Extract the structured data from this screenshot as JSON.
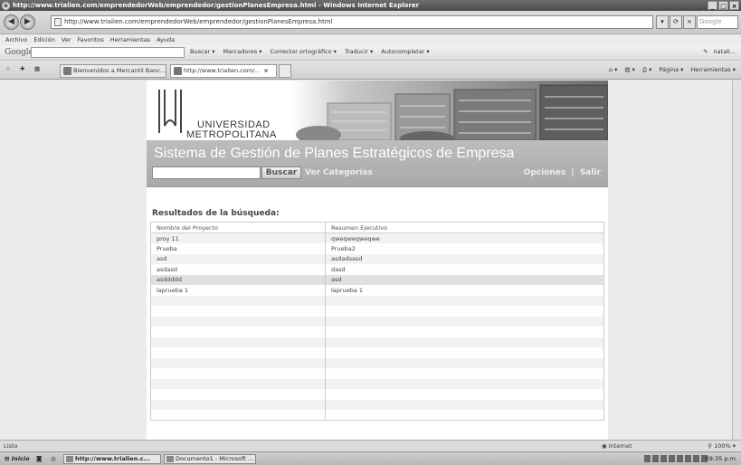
{
  "window": {
    "title": "http://www.trialien.com/emprendedorWeb/emprendedor/gestionPlanesEmpresa.html - Windows Internet Explorer"
  },
  "address": {
    "url": "http://www.trialien.com/emprendedorWeb/emprendedor/gestionPlanesEmpresa.html",
    "search_placeholder": "Google"
  },
  "menu": [
    "Archivo",
    "Edición",
    "Ver",
    "Favoritos",
    "Herramientas",
    "Ayuda"
  ],
  "google_toolbar": {
    "logo": "Google",
    "items": [
      "Buscar ▾",
      "Marcadores ▾",
      "Corrector ortográfico ▾",
      "Traducir ▾",
      "Autocompletar ▾"
    ],
    "user": "natali..."
  },
  "tabs": [
    {
      "label": "Bienvenidos a Mercantil Banc..."
    },
    {
      "label": "http://www.trialien.com/..."
    }
  ],
  "tab_tools": [
    "Página ▾",
    "Herramientas ▾"
  ],
  "page": {
    "university_line1": "UNIVERSIDAD",
    "university_line2": "METROPOLITANA",
    "app_title": "Sistema de Gestión de Planes Estratégicos de Empresa",
    "search_button": "Buscar",
    "categories_link": "Ver Categorías",
    "options_link": "Opciones",
    "separator": "|",
    "logout_link": "Salir",
    "results_title": "Resultados de la búsqueda:",
    "table": {
      "headers": [
        "Nombre del Proyecto",
        "Resumen Ejecutivo"
      ],
      "rows": [
        [
          "proy 11",
          "qweqweqweqwe"
        ],
        [
          "Prueba",
          "Prueba2"
        ],
        [
          "asd",
          "asdadsasd"
        ],
        [
          "asdasd",
          "dasd"
        ],
        [
          "asddddd",
          "asd"
        ],
        [
          "laprueba 1",
          "laprueba 1"
        ]
      ]
    }
  },
  "status": {
    "text": "Listo",
    "zone": "Internet",
    "zoom": "100%"
  },
  "taskbar": {
    "start": "Inicio",
    "items": [
      "http://www.trialien.c...",
      "Documento1 - Microsoft ..."
    ],
    "clock": "09:35 p.m."
  }
}
